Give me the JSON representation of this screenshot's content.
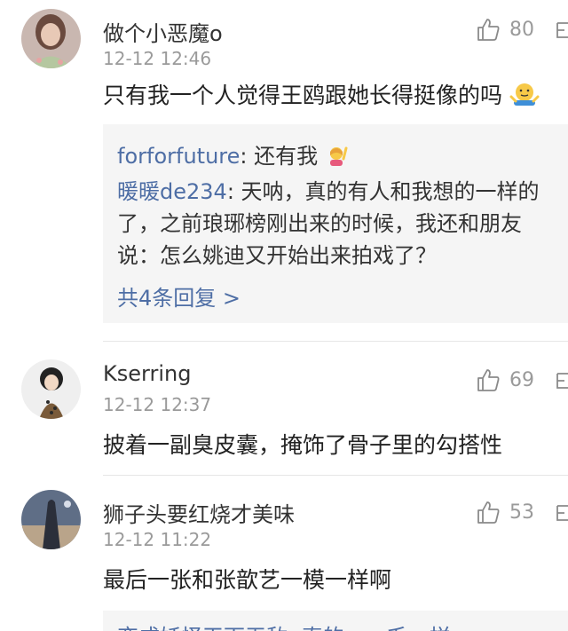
{
  "comments": [
    {
      "username": "做个小恶魔o",
      "time": "12-12 12:46",
      "likes": "80",
      "text": "只有我一个人觉得王鸥跟她长得挺像的吗",
      "emoji_icon": "shrug-emoji-icon",
      "replies": [
        {
          "name": "forforfuture",
          "sep": ": ",
          "text": "还有我",
          "emoji_icon": "woman-raising-hand-emoji-icon"
        },
        {
          "name": "暖暖de234",
          "sep": ": ",
          "lines": [
            "天呐，真的有人和我想的一样的",
            "了，之前琅琊榜刚出来的时候，我还和朋友",
            "说：怎么姚迪又开始出来拍戏了？"
          ]
        }
      ],
      "see_more": "共4条回复 >"
    },
    {
      "username": "Kserring",
      "time": "12-12 12:37",
      "likes": "69",
      "text": "披着一副臭皮囊，掩饰了骨子里的勾搭性"
    },
    {
      "username": "狮子头要红烧才美味",
      "time": "12-12 11:22",
      "likes": "53",
      "text": "最后一张和张歆艺一模一样啊",
      "partial_reply": "变成妖怪天下无敌: 真的，一毛一样"
    }
  ],
  "colors": {
    "link": "#4e6ea5",
    "meta": "#9a9a9a",
    "reply_bg": "#f5f5f5"
  }
}
